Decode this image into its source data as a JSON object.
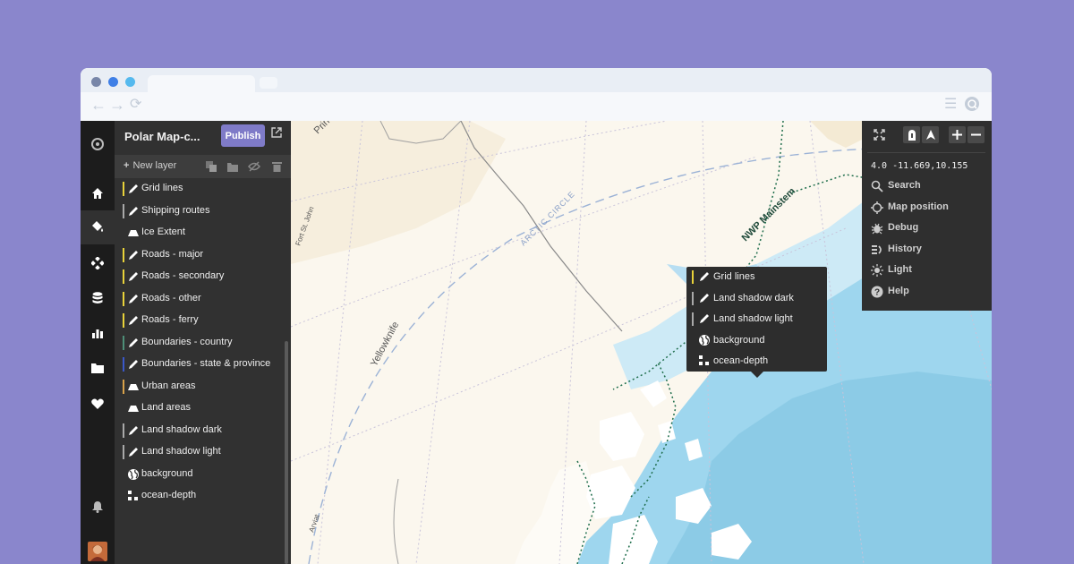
{
  "colors": {
    "page_bg": "#8a86cc",
    "accent": "#7f7bc8",
    "panel_bg": "#313131",
    "sidebar_bg": "#1c1c1c",
    "water": "#9ed6ee",
    "land": "#fbf7ee"
  },
  "browser": {
    "window_dots": [
      "#7886a8",
      "#3f7fe6",
      "#55b9ee"
    ],
    "nav_icons": [
      "back-arrow-icon",
      "forward-arrow-icon",
      "refresh-icon",
      "menu-icon",
      "extension-icon"
    ]
  },
  "iconbar": {
    "items": [
      "logo-icon",
      "home-icon",
      "style-icon",
      "components-icon",
      "data-icon",
      "stats-icon",
      "folder-icon",
      "heart-icon",
      "bell-icon",
      "avatar"
    ]
  },
  "panel": {
    "title": "Polar Map-c...",
    "publish_label": "Publish",
    "new_layer_label": "New layer",
    "layers": [
      {
        "name": "Grid lines",
        "icon": "line-icon",
        "color": "#e8d23a"
      },
      {
        "name": "Shipping routes",
        "icon": "line-icon",
        "color": "#a9a9a9"
      },
      {
        "name": "Ice Extent",
        "icon": "fill-icon",
        "color": ""
      },
      {
        "name": "Roads - major",
        "icon": "line-icon",
        "color": "#e8d23a"
      },
      {
        "name": "Roads - secondary",
        "icon": "line-icon",
        "color": "#e8d23a"
      },
      {
        "name": "Roads - other",
        "icon": "line-icon",
        "color": "#e8d23a"
      },
      {
        "name": "Roads - ferry",
        "icon": "line-icon",
        "color": "#e8d23a"
      },
      {
        "name": "Boundaries - country",
        "icon": "line-icon",
        "color": "#4e8f78"
      },
      {
        "name": "Boundaries - state & province",
        "icon": "line-icon",
        "color": "#3a58c9"
      },
      {
        "name": "Urban areas",
        "icon": "fill-icon",
        "color": "#d9a24a"
      },
      {
        "name": "Land areas",
        "icon": "fill-icon",
        "color": ""
      },
      {
        "name": "Land shadow dark",
        "icon": "line-icon",
        "color": "#a9a9a9"
      },
      {
        "name": "Land shadow light",
        "icon": "line-icon",
        "color": "#a9a9a9"
      },
      {
        "name": "background",
        "icon": "globe-icon",
        "color": ""
      },
      {
        "name": "ocean-depth",
        "icon": "raster-icon",
        "color": ""
      }
    ]
  },
  "popup": {
    "items": [
      {
        "name": "Grid lines",
        "icon": "line-icon",
        "color": "#e8d23a"
      },
      {
        "name": "Land shadow dark",
        "icon": "line-icon",
        "color": "#a9a9a9"
      },
      {
        "name": "Land shadow light",
        "icon": "line-icon",
        "color": "#a9a9a9"
      },
      {
        "name": "background",
        "icon": "globe-icon",
        "color": ""
      },
      {
        "name": "ocean-depth",
        "icon": "raster-icon",
        "color": ""
      }
    ]
  },
  "map": {
    "labels": {
      "prin": "Prin",
      "fort_st_john": "Fort St. John",
      "yellowknife": "Yellowknife",
      "arctic_circle": "ARCTIC CIRCLE",
      "nwp_mainstem": "NWP Mainstem",
      "arviat": "Arviat"
    }
  },
  "controls": {
    "coords": "4.0 -11.669,10.155",
    "items": [
      {
        "label": "Search",
        "icon": "search-icon"
      },
      {
        "label": "Map position",
        "icon": "crosshair-icon"
      },
      {
        "label": "Debug",
        "icon": "bug-icon"
      },
      {
        "label": "History",
        "icon": "history-icon"
      },
      {
        "label": "Light",
        "icon": "sun-icon"
      },
      {
        "label": "Help",
        "icon": "help-icon"
      }
    ]
  }
}
